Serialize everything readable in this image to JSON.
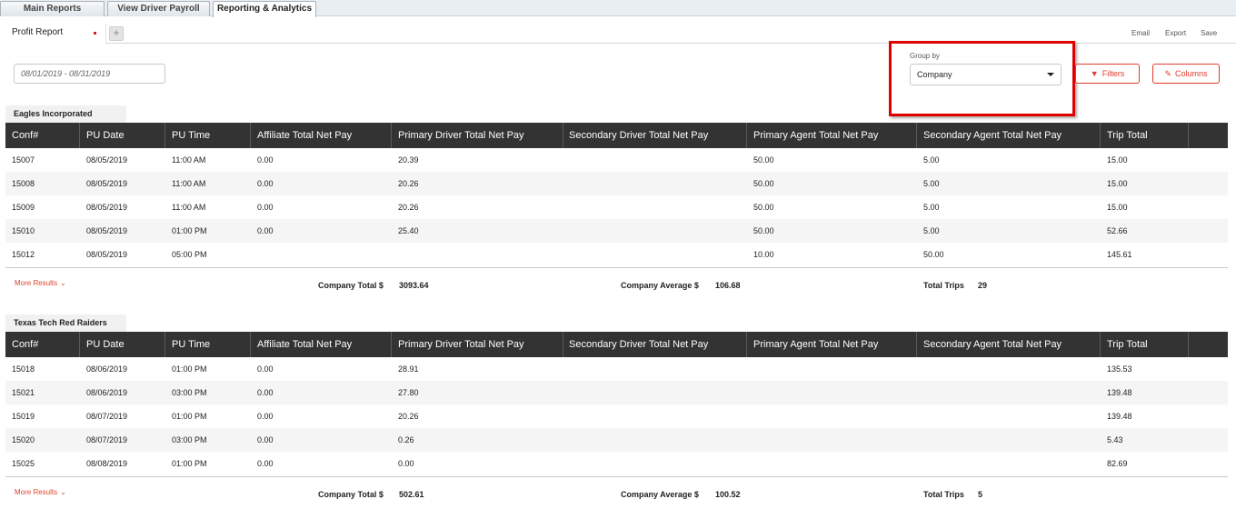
{
  "topnav": {
    "tabs": [
      {
        "label": "Main Reports"
      },
      {
        "label": "View Driver Payroll"
      },
      {
        "label": "Reporting & Analytics"
      }
    ]
  },
  "report_tab": {
    "label": "Profit Report",
    "add_label": "+"
  },
  "toolbar": {
    "email": "Email",
    "export": "Export",
    "save": "Save"
  },
  "filters": {
    "date_range": "08/01/2019 - 08/31/2019",
    "group_by_label": "Group by",
    "group_by_value": "Company",
    "filters_button": "Filters",
    "columns_button": "Columns"
  },
  "columns": [
    "Conf#",
    "PU Date",
    "PU Time",
    "Affiliate Total Net Pay",
    "Primary Driver Total Net Pay",
    "Secondary Driver Total Net Pay",
    "Primary Agent Total Net Pay",
    "Secondary Agent Total Net Pay",
    "Trip Total"
  ],
  "groups": [
    {
      "title": "Eagles Incorporated",
      "rows": [
        [
          "15007",
          "08/05/2019",
          "11:00 AM",
          "0.00",
          "20.39",
          "",
          "50.00",
          "5.00",
          "15.00"
        ],
        [
          "15008",
          "08/05/2019",
          "11:00 AM",
          "0.00",
          "20.26",
          "",
          "50.00",
          "5.00",
          "15.00"
        ],
        [
          "15009",
          "08/05/2019",
          "11:00 AM",
          "0.00",
          "20.26",
          "",
          "50.00",
          "5.00",
          "15.00"
        ],
        [
          "15010",
          "08/05/2019",
          "01:00 PM",
          "0.00",
          "25.40",
          "",
          "50.00",
          "5.00",
          "52.66"
        ],
        [
          "15012",
          "08/05/2019",
          "05:00 PM",
          "",
          "",
          "",
          "10.00",
          "50.00",
          "145.61"
        ]
      ],
      "more_results": "More Results",
      "company_total_label": "Company Total $",
      "company_total": "3093.64",
      "company_average_label": "Company Average $",
      "company_average": "106.68",
      "total_trips_label": "Total Trips",
      "total_trips": "29"
    },
    {
      "title": "Texas Tech Red Raiders",
      "rows": [
        [
          "15018",
          "08/06/2019",
          "01:00 PM",
          "0.00",
          "28.91",
          "",
          "",
          "",
          "135.53"
        ],
        [
          "15021",
          "08/06/2019",
          "03:00 PM",
          "0.00",
          "27.80",
          "",
          "",
          "",
          "139.48"
        ],
        [
          "15019",
          "08/07/2019",
          "01:00 PM",
          "0.00",
          "20.26",
          "",
          "",
          "",
          "139.48"
        ],
        [
          "15020",
          "08/07/2019",
          "03:00 PM",
          "0.00",
          "0.26",
          "",
          "",
          "",
          "5.43"
        ],
        [
          "15025",
          "08/08/2019",
          "01:00 PM",
          "0.00",
          "0.00",
          "",
          "",
          "",
          "82.69"
        ]
      ],
      "more_results": "More Results",
      "company_total_label": "Company Total $",
      "company_total": "502.61",
      "company_average_label": "Company Average $",
      "company_average": "100.52",
      "total_trips_label": "Total Trips",
      "total_trips": "5"
    }
  ]
}
